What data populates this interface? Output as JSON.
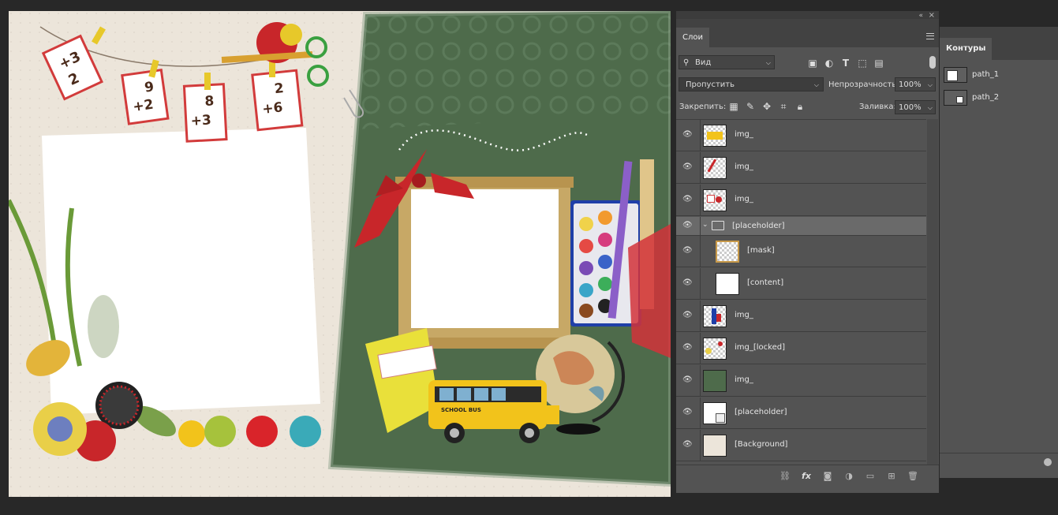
{
  "layers_panel": {
    "tab_label": "Слои",
    "filter_kind": "Вид",
    "blend_mode": "Пропустить",
    "opacity_label": "Непрозрачность:",
    "opacity_value": "100%",
    "lock_label": "Закрепить:",
    "fill_label": "Заливка:",
    "fill_value": "100%",
    "layers": [
      {
        "name": "img_",
        "thumb": "bus"
      },
      {
        "name": "img_",
        "thumb": "bow"
      },
      {
        "name": "img_",
        "thumb": "cards"
      },
      {
        "name": "[placeholder]",
        "type": "group",
        "expanded": true
      },
      {
        "name": "[mask]",
        "thumb": "mask",
        "indent": true
      },
      {
        "name": "[content]",
        "thumb": "white",
        "indent": true
      },
      {
        "name": "img_",
        "thumb": "paints"
      },
      {
        "name": "img_[locked]",
        "thumb": "flowers"
      },
      {
        "name": "img_",
        "thumb": "green"
      },
      {
        "name": "[placeholder]",
        "thumb": "placeholder"
      },
      {
        "name": "[Background]",
        "thumb": "bg"
      }
    ]
  },
  "paths_panel": {
    "tab_label": "Контуры",
    "paths": [
      {
        "name": "path_1"
      },
      {
        "name": "path_2"
      }
    ]
  },
  "canvas": {
    "bus_sign": "SCHOOL BUS",
    "cards": [
      {
        "top": "+3",
        "bottom": "2"
      },
      {
        "top": "9",
        "bottom": "+2"
      },
      {
        "top": "8",
        "bottom": "+3"
      },
      {
        "top": "2",
        "bottom": "+6"
      }
    ]
  }
}
